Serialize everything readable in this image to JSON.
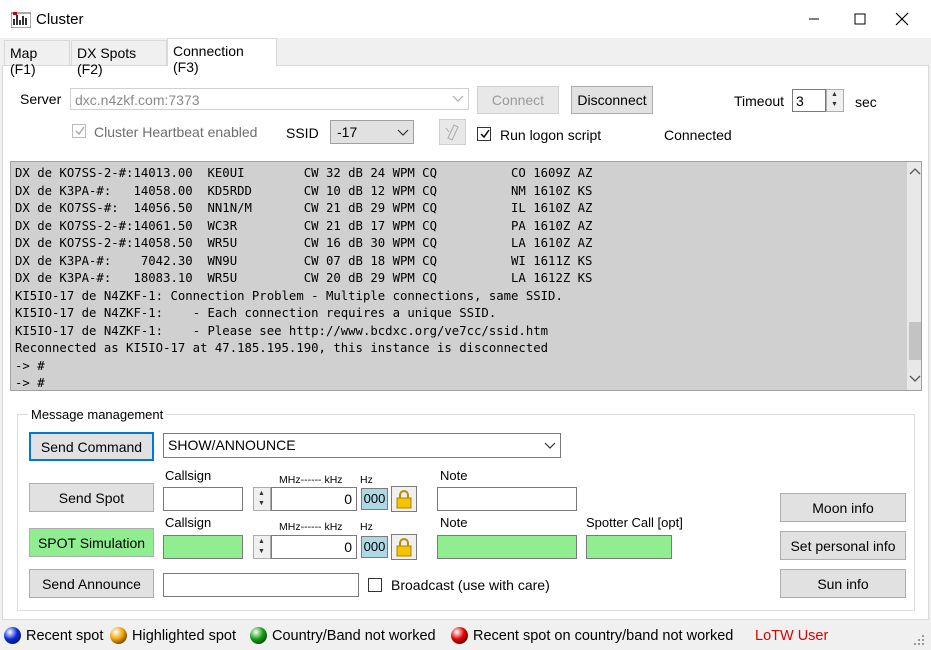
{
  "window": {
    "title": "Cluster"
  },
  "tabs": [
    {
      "label": "Map (F1)"
    },
    {
      "label": "DX Spots (F2)"
    },
    {
      "label": "Connection (F3)"
    }
  ],
  "connection": {
    "server_label": "Server",
    "server_value": "dxc.n4zkf.com:7373",
    "connect_label": "Connect",
    "disconnect_label": "Disconnect",
    "timeout_label": "Timeout",
    "timeout_value": "3",
    "timeout_unit": "sec",
    "heartbeat_label": "Cluster Heartbeat enabled",
    "ssid_label": "SSID",
    "ssid_value": "-17",
    "logon_script_label": "Run logon script",
    "status": "Connected"
  },
  "console_lines": [
    "DX de KO7SS-2-#:14013.00  KE0UI        CW 32 dB 24 WPM CQ          CO 1609Z AZ",
    "DX de K3PA-#:   14058.00  KD5RDD       CW 10 dB 12 WPM CQ          NM 1610Z KS",
    "DX de KO7SS-#:  14056.50  NN1N/M       CW 21 dB 29 WPM CQ          IL 1610Z AZ",
    "DX de KO7SS-2-#:14061.50  WC3R         CW 21 dB 17 WPM CQ          PA 1610Z AZ",
    "DX de KO7SS-2-#:14058.50  WR5U         CW 16 dB 30 WPM CQ          LA 1610Z AZ",
    "DX de K3PA-#:    7042.30  WN9U         CW 07 dB 18 WPM CQ          WI 1611Z KS",
    "DX de K3PA-#:   18083.10  WR5U         CW 20 dB 29 WPM CQ          LA 1612Z KS",
    "KI5IO-17 de N4ZKF-1: Connection Problem - Multiple connections, same SSID.",
    "KI5IO-17 de N4ZKF-1:    - Each connection requires a unique SSID.",
    "KI5IO-17 de N4ZKF-1:    - Please see http://www.bcdxc.org/ve7cc/ssid.htm",
    "Reconnected as KI5IO-17 at 47.185.195.190, this instance is disconnected",
    "-> #",
    "-> #"
  ],
  "message": {
    "group_label": "Message management",
    "send_command_label": "Send Command",
    "command_value": "SHOW/ANNOUNCE",
    "send_spot_label": "Send Spot",
    "spot_sim_label": "SPOT Simulation",
    "send_announce_label": "Send Announce",
    "callsign_label": "Callsign",
    "mhz_khz_label": "MHz------ kHz",
    "hz_label": "Hz",
    "freq_value": "0",
    "hz_value": "000",
    "note_label": "Note",
    "spotter_label": "Spotter Call [opt]",
    "broadcast_label": "Broadcast (use with care)",
    "moon_label": "Moon info",
    "personal_label": "Set personal info",
    "sun_label": "Sun info"
  },
  "legend": [
    {
      "label": "Recent spot",
      "color": "#0a2ad8"
    },
    {
      "label": "Highlighted spot",
      "color": "#f0a000"
    },
    {
      "label": "Country/Band not worked",
      "color": "#10a010"
    },
    {
      "label": "Recent spot on country/band not worked",
      "color": "#e00000"
    }
  ],
  "lotw_label": "LoTW User",
  "colors": {
    "accent": "#0078d7",
    "lotw": "#e00000",
    "sim_button": "#90ee90"
  }
}
